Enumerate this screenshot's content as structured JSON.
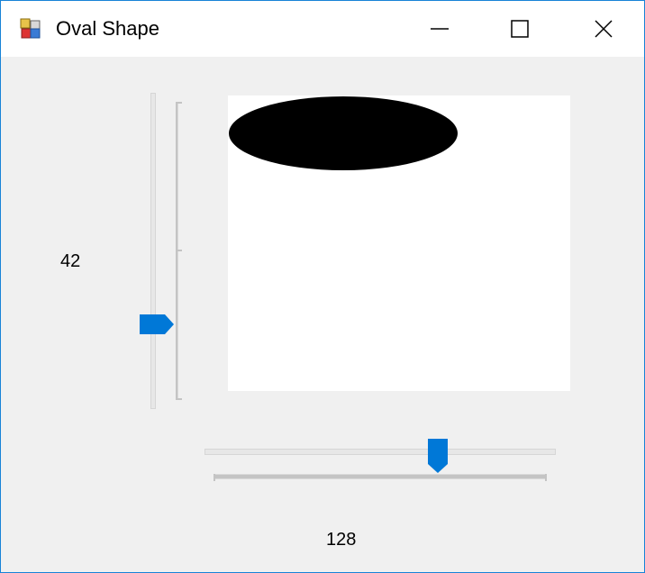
{
  "window": {
    "title": "Oval Shape",
    "icon": "app-icon",
    "controls": [
      "minimize-icon",
      "maximize-icon",
      "close-icon"
    ]
  },
  "vertical_slider": {
    "value_label": "42",
    "position_fraction": 0.27
  },
  "horizontal_slider": {
    "value_label": "128",
    "position_fraction": 0.67
  },
  "colors": {
    "accent": "#0078d7",
    "frame": "#1883d7",
    "oval": "#000000",
    "background": "#f0f0f0"
  }
}
